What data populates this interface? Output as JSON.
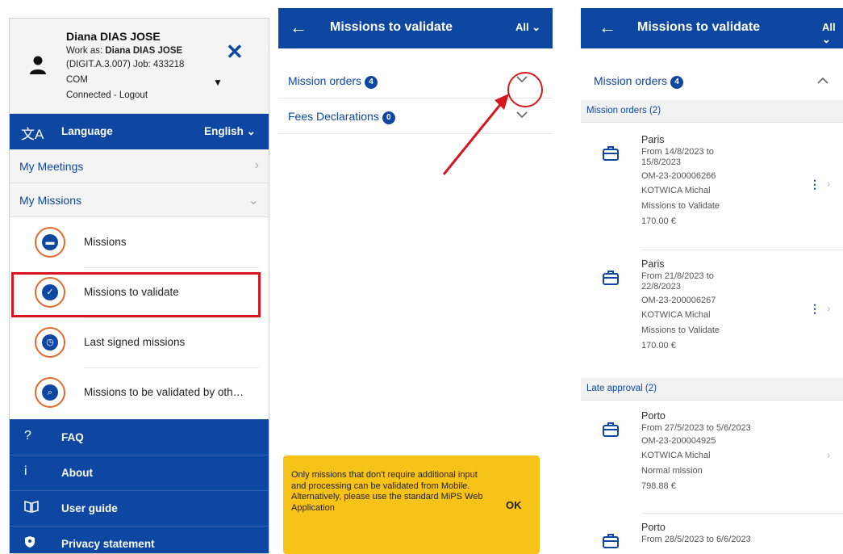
{
  "colors": {
    "primary": "#0e47a1",
    "accent_orange": "#e16a2c",
    "highlight_red": "#d7171e",
    "toast_yellow": "#f7c318"
  },
  "menu": {
    "user_name": "Diana DIAS JOSE",
    "work_as_prefix": "Work as: ",
    "work_as_name": "Diana DIAS JOSE",
    "dept": "(DIGIT.A.3.007) Job: 433218",
    "com": "COM",
    "connected": "Connected - Logout",
    "language_label": "Language",
    "language_value": "English ⌄",
    "my_meetings": "My Meetings",
    "my_missions": "My Missions",
    "sub_items": [
      {
        "label": "Missions",
        "icon": "briefcase-icon"
      },
      {
        "label": "Missions to validate",
        "icon": "briefcase-check-icon"
      },
      {
        "label": "Last signed missions",
        "icon": "stopwatch-icon"
      },
      {
        "label": "Missions to be validated by oth…",
        "icon": "search-icon"
      }
    ],
    "footer": [
      {
        "label": "FAQ",
        "icon": "?"
      },
      {
        "label": "About",
        "icon": "i"
      },
      {
        "label": "User guide",
        "icon": "book-icon"
      },
      {
        "label": "Privacy statement",
        "icon": "shield-icon"
      }
    ]
  },
  "screen2": {
    "back": "←",
    "title": "Missions to validate",
    "filter": "All ⌄",
    "acc1_label": "Mission orders",
    "acc1_count": "4",
    "acc2_label": "Fees Declarations",
    "acc2_count": "0",
    "toast_msg": "Only missions that don't require additional input and processing can be validated from Mobile. Alternatively, please use the standard MiPS Web Application",
    "toast_ok": "OK"
  },
  "screen3": {
    "back": "←",
    "title": "Missions to validate",
    "filter": "All ⌄",
    "acc_label": "Mission orders",
    "acc_count": "4",
    "group1": "Mission orders (2)",
    "group2": "Late approval (2)",
    "items": [
      {
        "city": "Paris",
        "dates1": "From 14/8/2023 to",
        "dates2": "15/8/2023",
        "ref": "OM-23-200006266",
        "person": "KOTWICA Michal",
        "type": "Missions to Validate",
        "amount": "170.00 €"
      },
      {
        "city": "Paris",
        "dates1": "From 21/8/2023 to",
        "dates2": "22/8/2023",
        "ref": "OM-23-200006267",
        "person": "KOTWICA Michal",
        "type": "Missions to Validate",
        "amount": "170.00 €"
      },
      {
        "city": "Porto",
        "dates1": "From 27/5/2023 to 5/6/2023",
        "ref": "OM-23-200004925",
        "person": "KOTWICA Michal",
        "type": "Normal mission",
        "amount": "798.88 €"
      },
      {
        "city": "Porto",
        "dates1": "From 28/5/2023 to 6/6/2023"
      }
    ]
  }
}
